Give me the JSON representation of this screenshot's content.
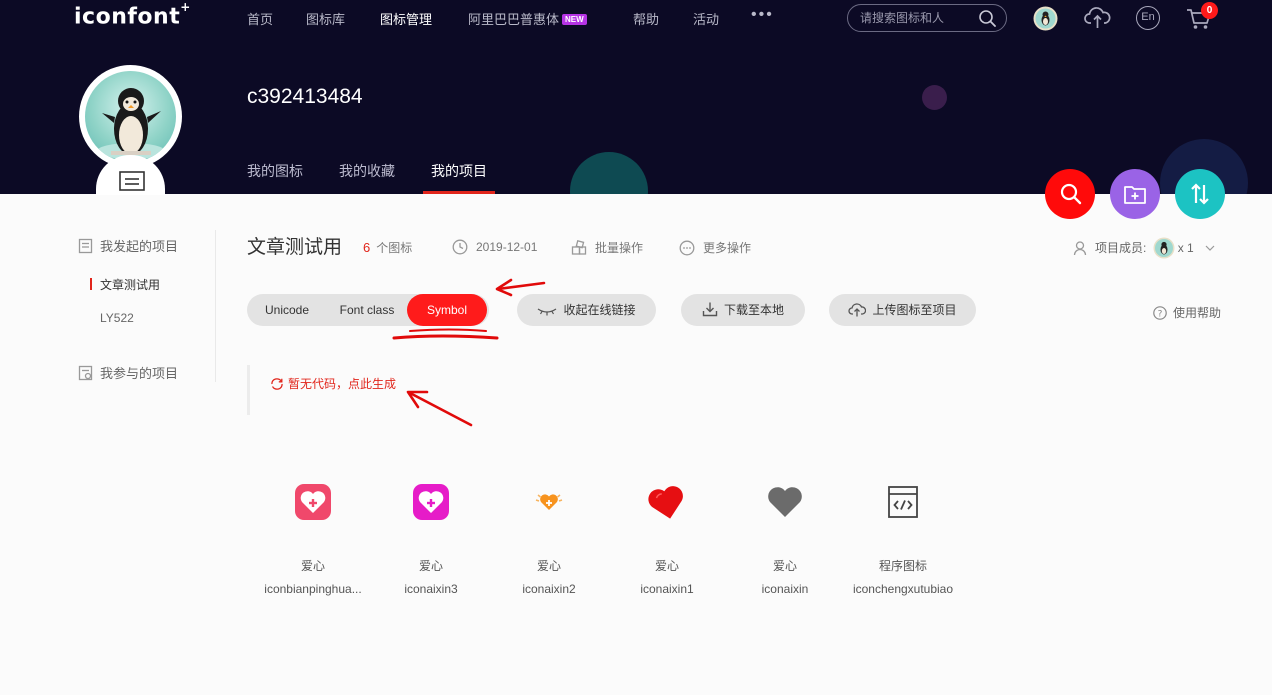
{
  "nav": {
    "logo": "iconfont",
    "items": [
      {
        "label": "首页"
      },
      {
        "label": "图标库"
      },
      {
        "label": "图标管理"
      },
      {
        "label": "阿里巴巴普惠体"
      },
      {
        "label": "帮助"
      },
      {
        "label": "活动"
      }
    ],
    "new_badge": "NEW",
    "more": "•••",
    "search_placeholder": "请搜索图标和人",
    "lang": "En",
    "cart_count": "0"
  },
  "profile": {
    "username": "c392413484",
    "tabs": [
      {
        "label": "我的图标"
      },
      {
        "label": "我的收藏"
      },
      {
        "label": "我的项目"
      }
    ]
  },
  "sidebar": {
    "my_projects": "我发起的项目",
    "items": [
      {
        "label": "文章测试用"
      },
      {
        "label": "LY522"
      }
    ],
    "joined_projects": "我参与的项目"
  },
  "project": {
    "title": "文章测试用",
    "icon_count": "6",
    "icon_count_unit": "个图标",
    "date": "2019-12-01",
    "batch": "批量操作",
    "more_ops": "更多操作",
    "members_label": "项目成员:",
    "members_count": "x 1"
  },
  "toolbar": {
    "formats": [
      {
        "label": "Unicode"
      },
      {
        "label": "Font class"
      },
      {
        "label": "Symbol"
      }
    ],
    "collapse_link": "收起在线链接",
    "download": "下载至本地",
    "upload": "上传图标至项目",
    "help": "使用帮助"
  },
  "code": {
    "empty_message": "暂无代码，点此生成"
  },
  "icons": [
    {
      "name": "爱心",
      "code": "iconbianpinghua...",
      "icon": "heart-square-pink-icon"
    },
    {
      "name": "爱心",
      "code": "iconaixin3",
      "icon": "heart-square-magenta-icon"
    },
    {
      "name": "爱心",
      "code": "iconaixin2",
      "icon": "heart-orange-icon"
    },
    {
      "name": "爱心",
      "code": "iconaixin1",
      "icon": "heart-red-icon"
    },
    {
      "name": "爱心",
      "code": "iconaixin",
      "icon": "heart-gray-icon"
    },
    {
      "name": "程序图标",
      "code": "iconchengxutubiao",
      "icon": "code-window-icon"
    }
  ],
  "colors": {
    "nav_bg": "#0c0a25",
    "accent": "#ff1b1b",
    "fab_search": "#ff0a0a",
    "fab_folder": "#9a63e6",
    "fab_sort": "#1cc3c3"
  }
}
